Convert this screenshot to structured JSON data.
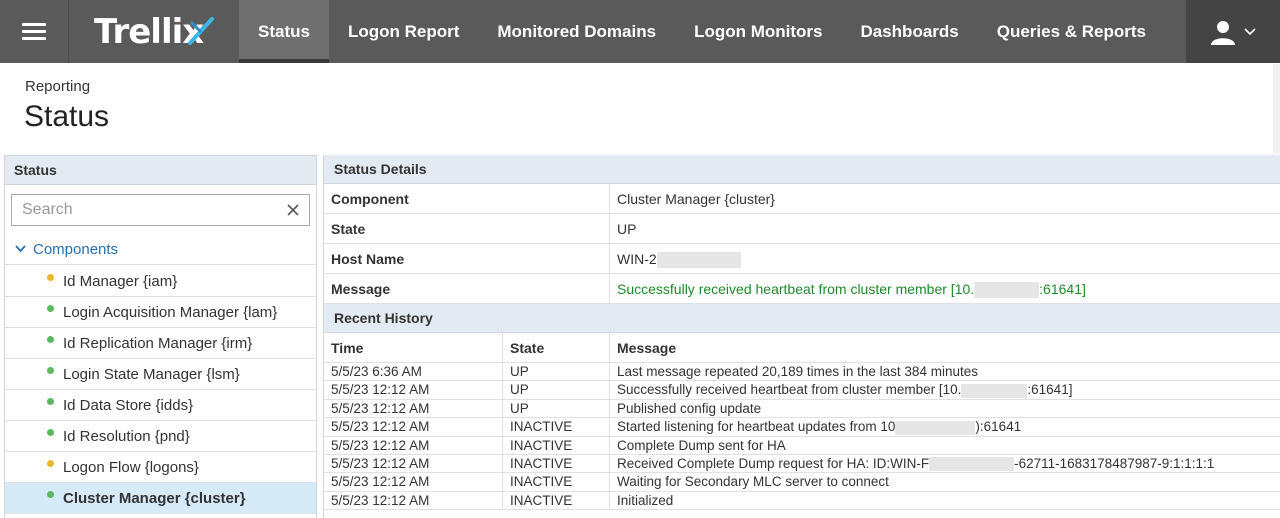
{
  "app": {
    "logo_text": "Trellix",
    "nav": [
      {
        "label": "Status",
        "active": true
      },
      {
        "label": "Logon Report",
        "active": false
      },
      {
        "label": "Monitored Domains",
        "active": false
      },
      {
        "label": "Logon Monitors",
        "active": false
      },
      {
        "label": "Dashboards",
        "active": false
      },
      {
        "label": "Queries & Reports",
        "active": false
      }
    ]
  },
  "header": {
    "breadcrumb": "Reporting",
    "title": "Status"
  },
  "left_panel": {
    "title": "Status",
    "search_placeholder": "Search",
    "tree_root": "Components",
    "items": [
      {
        "label": "Id Manager {iam}",
        "status_color": "#e6b82e",
        "selected": false
      },
      {
        "label": "Login Acquisition Manager {lam}",
        "status_color": "#5cb85c",
        "selected": false
      },
      {
        "label": "Id Replication Manager {irm}",
        "status_color": "#5cb85c",
        "selected": false
      },
      {
        "label": "Login State Manager {lsm}",
        "status_color": "#5cb85c",
        "selected": false
      },
      {
        "label": "Id Data Store {idds}",
        "status_color": "#5cb85c",
        "selected": false
      },
      {
        "label": "Id Resolution {pnd}",
        "status_color": "#5cb85c",
        "selected": false
      },
      {
        "label": "Logon Flow {logons}",
        "status_color": "#e6b82e",
        "selected": false
      },
      {
        "label": "Cluster Manager {cluster}",
        "status_color": "#5cb85c",
        "selected": true
      }
    ]
  },
  "details": {
    "title": "Status Details",
    "rows": [
      {
        "label": "Component",
        "value": "Cluster Manager {cluster}"
      },
      {
        "label": "State",
        "value": "UP"
      },
      {
        "label": "Host Name",
        "value": "WIN-2"
      },
      {
        "label": "Message",
        "value_prefix": "Successfully received heartbeat from cluster member [10.",
        "value_suffix": ":61641]"
      }
    ]
  },
  "history": {
    "title": "Recent History",
    "columns": [
      "Time",
      "State",
      "Message"
    ],
    "rows": [
      {
        "time": "5/5/23 6:36 AM",
        "state": "UP",
        "message": "Last message repeated 20,189 times in the last 384 minutes"
      },
      {
        "time": "5/5/23 12:12 AM",
        "state": "UP",
        "message": "Successfully received heartbeat from cluster member [10.",
        "suffix": ":61641]"
      },
      {
        "time": "5/5/23 12:12 AM",
        "state": "UP",
        "message": "Published config update"
      },
      {
        "time": "5/5/23 12:12 AM",
        "state": "INACTIVE",
        "message": "Started listening for heartbeat updates from 10",
        "suffix": "):61641"
      },
      {
        "time": "5/5/23 12:12 AM",
        "state": "INACTIVE",
        "message": "Complete Dump sent for HA"
      },
      {
        "time": "5/5/23 12:12 AM",
        "state": "INACTIVE",
        "message": "Received Complete Dump request for HA: ID:WIN-F",
        "suffix": "-62711-1683178487987-9:1:1:1:1"
      },
      {
        "time": "5/5/23 12:12 AM",
        "state": "INACTIVE",
        "message": "Waiting for Secondary MLC server to connect"
      },
      {
        "time": "5/5/23 12:12 AM",
        "state": "INACTIVE",
        "message": "Initialized"
      }
    ]
  },
  "icons": {
    "menu": "hamburger-menu-icon",
    "user": "user-icon",
    "clear": "close-icon",
    "expand": "chevron-down-icon"
  }
}
